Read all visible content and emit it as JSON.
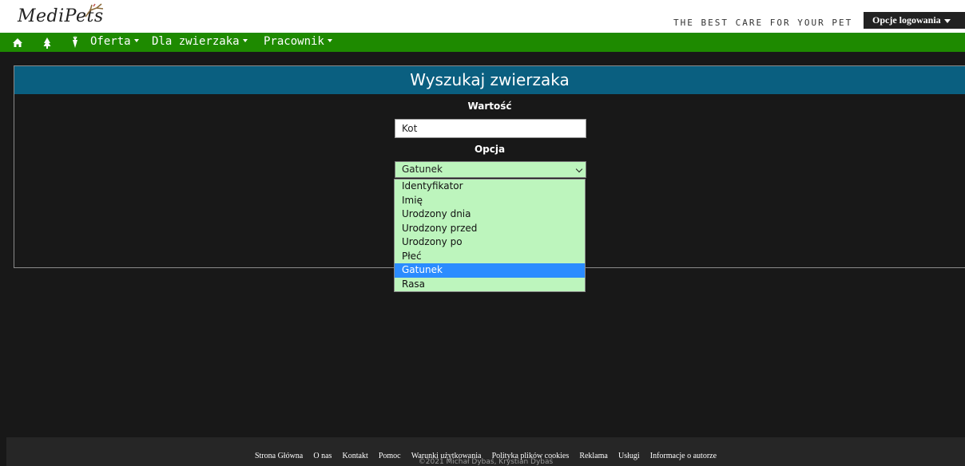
{
  "header": {
    "logo_text": "MediPets",
    "tagline": "THE BEST CARE FOR YOUR PET",
    "login_label": "Opcje logowania"
  },
  "nav": {
    "icons": [
      "home-icon",
      "tree-icon",
      "carrot-icon"
    ],
    "menus": [
      "Oferta",
      "Dla zwierzaka",
      "Pracownik"
    ]
  },
  "search": {
    "title": "Wyszukaj zwierzaka",
    "value_label": "Wartość",
    "value": "Kot",
    "option_label": "Opcja",
    "selected": "Gatunek",
    "options": [
      "Identyfikator",
      "Imię",
      "Urodzony dnia",
      "Urodzony przed",
      "Urodzony po",
      "Płeć",
      "Gatunek",
      "Rasa"
    ]
  },
  "footer": {
    "links": [
      "Strona Główna",
      "O nas",
      "Kontakt",
      "Pomoc",
      "Warunki użytkowania",
      "Polityka plików cookies",
      "Reklama",
      "Usługi",
      "Informacje o autorze"
    ],
    "copyright": "©2021 Michał Dybaś, Krystian Dybaś"
  },
  "colors": {
    "nav_green": "#1e8a00",
    "title_blue": "#0a5f80",
    "select_green": "#bdf5bd",
    "selected_blue": "#2b8cff"
  }
}
